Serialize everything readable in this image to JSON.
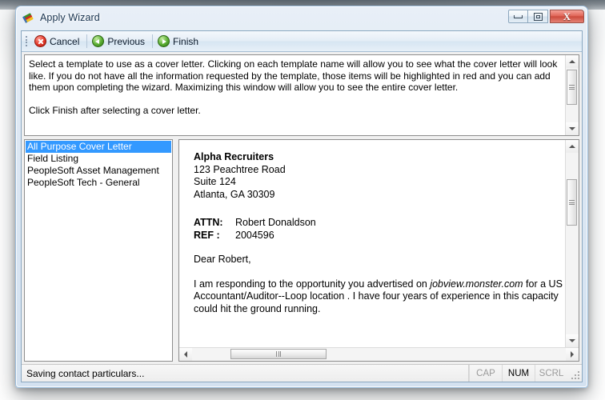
{
  "window": {
    "title": "Apply Wizard",
    "icon": "colored-blocks-icon",
    "caption_buttons": {
      "minimize": "minimize-button",
      "restore": "restore-button",
      "close": "close-button",
      "close_glyph": "X"
    }
  },
  "toolbar": {
    "cancel_label": "Cancel",
    "previous_label": "Previous",
    "finish_label": "Finish"
  },
  "instructions": {
    "paragraph1": "Select a template to use as a cover letter.  Clicking on each template name will allow you to see what the cover letter will look like.  If you do not have all the information requested by the template, those items will be highlighted in red and you can add them upon completing the wizard.  Maximizing this window will allow you to see the entire cover letter.",
    "paragraph2": "Click Finish after selecting a cover letter."
  },
  "template_list": {
    "items": [
      {
        "label": "All Purpose Cover Letter",
        "selected": true
      },
      {
        "label": "Field Listing",
        "selected": false
      },
      {
        "label": "PeopleSoft Asset Management",
        "selected": false
      },
      {
        "label": "PeopleSoft Tech - General",
        "selected": false
      }
    ]
  },
  "letter": {
    "company": "Alpha Recruiters",
    "address_line1": "123 Peachtree Road",
    "address_line2": "Suite 124",
    "address_line3": "Atlanta, GA 30309",
    "attn_label": "ATTN:",
    "attn_value": "Robert Donaldson",
    "ref_label": "REF :",
    "ref_value": "2004596",
    "salutation": "Dear Robert,",
    "body_line1_a": "I am responding to the opportunity you advertised on ",
    "body_line1_italic": "jobview.monster.com",
    "body_line1_b": " for a US",
    "body_line2": "Accountant/Auditor--Loop location .  I have four years of experience in this capacity",
    "body_line3": "could hit the ground running."
  },
  "statusbar": {
    "message": "Saving contact particulars...",
    "cap_label": "CAP",
    "num_label": "NUM",
    "scrl_label": "SCRL"
  },
  "colors": {
    "selection_blue": "#3399ff",
    "titlebar_blue": "#18334f",
    "close_red": "#cc4b3d",
    "cancel_icon_red": "#e3392b",
    "nav_icon_green": "#5aae32"
  }
}
